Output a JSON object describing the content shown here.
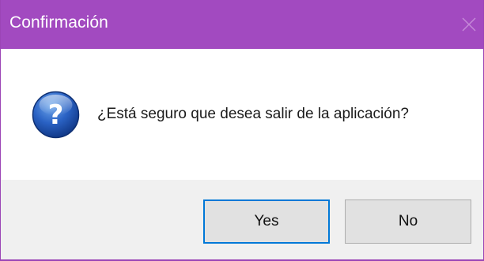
{
  "window": {
    "title": "Confirmación",
    "close_icon": "close-icon",
    "title_bar_color": "#a24ac0"
  },
  "message": {
    "icon": "question-icon",
    "text": "¿Está seguro que desea salir de la aplicación?"
  },
  "buttons": {
    "yes_label": "Yes",
    "no_label": "No",
    "default_focus_color": "#0078d7"
  }
}
